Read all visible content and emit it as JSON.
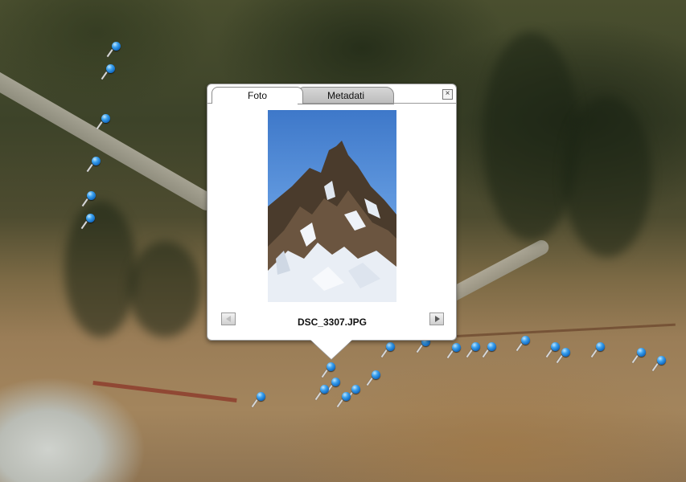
{
  "balloon": {
    "tabs": [
      {
        "label": "Foto",
        "active": true
      },
      {
        "label": "Metadati",
        "active": false
      }
    ],
    "close_icon": "close-icon",
    "photo_subject": "mountain-peak-photo",
    "filename": "DSC_3307.JPG",
    "prev_icon": "left-arrow-icon",
    "next_icon": "right-arrow-icon"
  },
  "map": {
    "marker_icon": "blue-pushpin-icon",
    "marker_color": "#1e7fd8"
  }
}
